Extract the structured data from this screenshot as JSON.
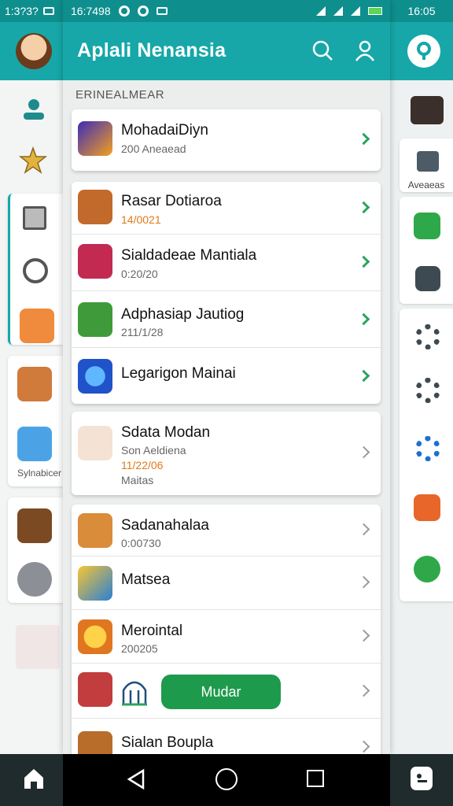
{
  "status": {
    "left_time": "1:3?3?",
    "main_time": "16:7498",
    "right_time": "16:05"
  },
  "main": {
    "title": "Aplali Nenansia",
    "section_label": "ERINEALMEAR",
    "group1": [
      {
        "name": "MohadaiDiyn",
        "sub": "200 Aneaead",
        "icon": "kite-app-icon",
        "color": "#4c3ec6"
      }
    ],
    "group2": [
      {
        "name": "Rasar Dotiaroa",
        "date": "14/0021",
        "icon": "character-app-icon",
        "color": "#c2692c"
      },
      {
        "name": "Sialdadeae Mantiala",
        "sub": "0:20/20",
        "icon": "clown-app-icon",
        "color": "#c22a52"
      },
      {
        "name": "Adphasiap Jautiog",
        "sub": "211/1/28",
        "icon": "frog-app-icon",
        "color": "#3f9b3a"
      },
      {
        "name": "Legarigon Mainai",
        "icon": "globe-app-icon",
        "color": "#2052c9"
      }
    ],
    "group3": [
      {
        "name": "Sdata Modan",
        "sub": "Son Aeldiena",
        "date": "11/22/06",
        "extra": "Maitas",
        "icon": "girl-app-icon",
        "color": "#c92b2b"
      }
    ],
    "group4": [
      {
        "name": "Sadanahalaa",
        "sub": "0:00730",
        "icon": "warrior-app-icon",
        "color": "#c9732c"
      },
      {
        "name": "Matsea",
        "icon": "sword-app-icon",
        "color": "#2a7fd6"
      },
      {
        "name": "Merointal",
        "sub": "200205",
        "icon": "emoji-app-icon",
        "color": "#e07620"
      },
      {
        "name": "",
        "icon": "puzzle-app-icon",
        "button": "Mudar",
        "color": "#c23d3d"
      },
      {
        "name": "Sialan Boupla",
        "icon": "temple-app-icon",
        "color": "#b96d2a"
      }
    ]
  },
  "left": {
    "label_sy": "Sylnabicer"
  },
  "right": {
    "label_av": "Aveaeas"
  },
  "colors": {
    "appbar": "#17a7a8",
    "status": "#0f8e8e",
    "accent_green": "#1e9a4c",
    "date_orange": "#e07a1a"
  }
}
